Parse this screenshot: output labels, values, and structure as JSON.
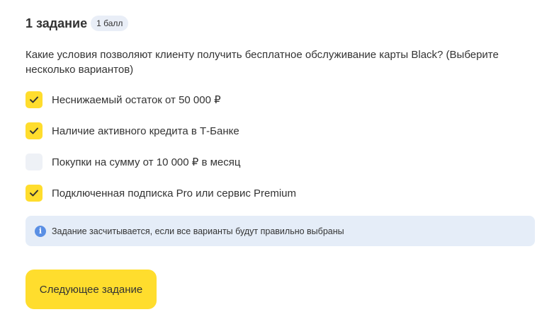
{
  "task": {
    "title": "1 задание",
    "points_badge": "1 балл"
  },
  "question": {
    "text": "Какие условия позволяют клиенту получить бесплатное обслуживание карты Black? (Выберите несколько вариантов)"
  },
  "options": [
    {
      "label": "Неснижаемый остаток от 50 000 ₽",
      "checked": true
    },
    {
      "label": "Наличие активного кредита в Т-Банке",
      "checked": true
    },
    {
      "label": "Покупки на сумму от 10 000 ₽ в месяц",
      "checked": false
    },
    {
      "label": "Подключенная подписка Pro или сервис Premium",
      "checked": true
    }
  ],
  "info": {
    "icon": "info-icon",
    "text": "Задание засчитывается, если все варианты будут правильно выбраны"
  },
  "actions": {
    "next_label": "Следующее задание"
  },
  "colors": {
    "accent": "#ffdd2d",
    "info_bg": "#e5edf8",
    "unchecked_bg": "#eef1f6",
    "info_icon": "#5a8fe4"
  }
}
